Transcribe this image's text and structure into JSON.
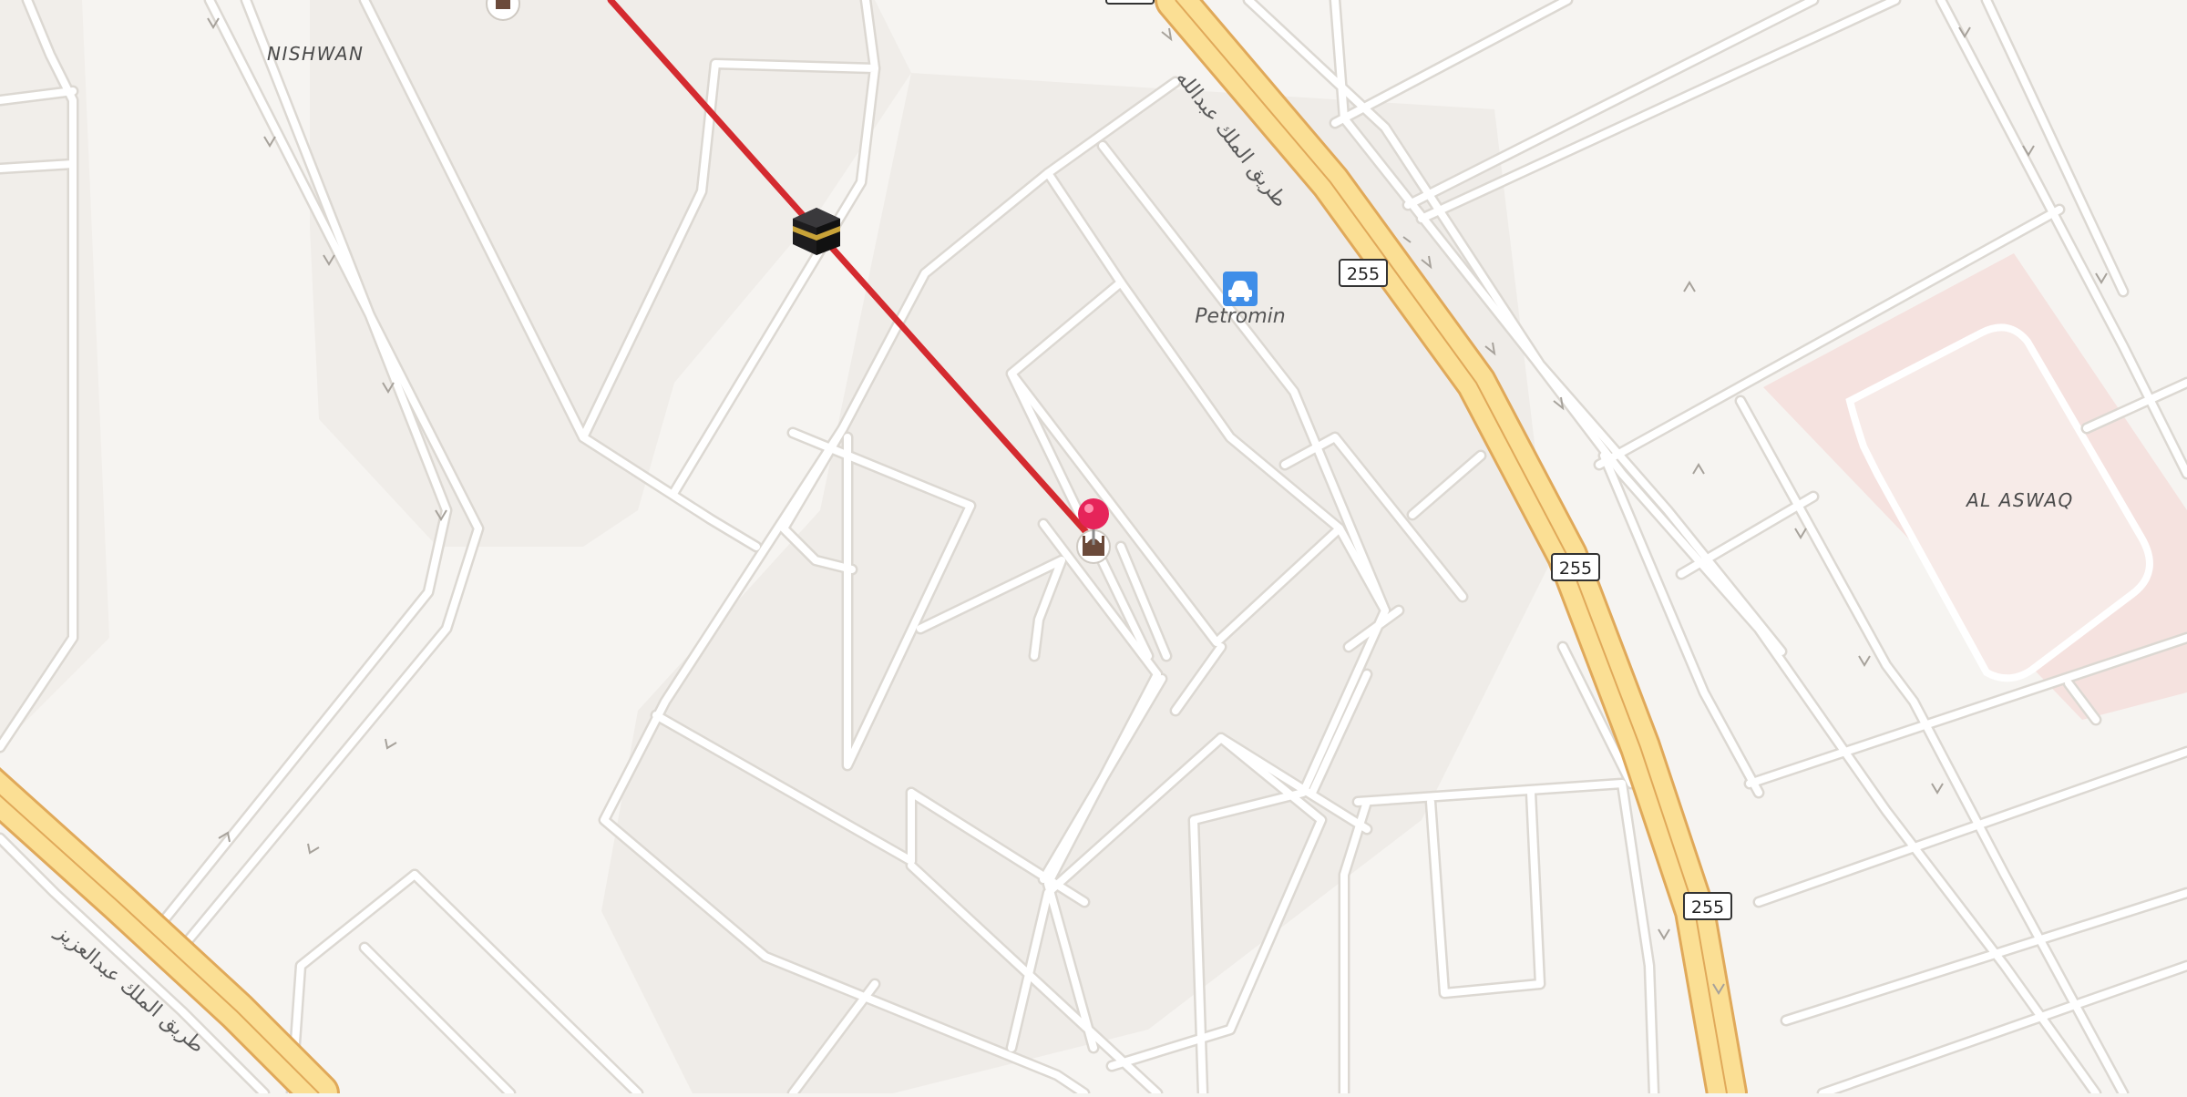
{
  "map": {
    "area_labels": {
      "nishwan": "NISHWAN",
      "al_aswaq": "AL ASWAQ"
    },
    "road_labels": {
      "upper_arabic": "طريق الملك عبدالله",
      "lower_arabic": "طريق الملك عبدالعزيز"
    },
    "poi": {
      "petromin": "Petromin",
      "petromin_icon": "car-icon"
    },
    "route_shields": {
      "s1": "255",
      "s2": "255",
      "s3": "255"
    },
    "markers": {
      "destination_pin_color": "#e6245a",
      "route_line_color": "#d42a2f",
      "qibla_icon": "kaaba-icon",
      "mosque_icon": "mosque-icon"
    },
    "colors": {
      "highway_fill": "#fbdf94",
      "highway_outline": "#e0a95a",
      "commercial_area": "#f5e2df",
      "background": "#f6f4f1"
    }
  }
}
